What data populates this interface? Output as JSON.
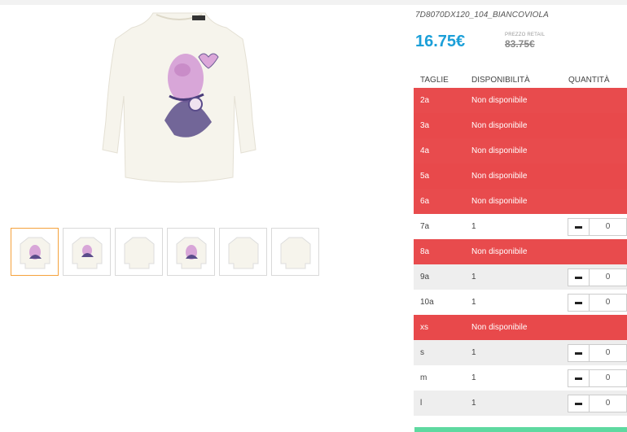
{
  "product": {
    "sku": "7D8070DX120_104_BIANCOVIOLA",
    "price": "16.75€",
    "retail_label": "PREZZO RETAIL",
    "retail_price": "83.75€"
  },
  "table": {
    "headers": [
      "TAGLIE",
      "DISPONIBILITÀ",
      "QUANTITÀ"
    ],
    "rows": [
      {
        "size": "2a",
        "availability": "Non disponibile",
        "qty": null
      },
      {
        "size": "3a",
        "availability": "Non disponibile",
        "qty": null
      },
      {
        "size": "4a",
        "availability": "Non disponibile",
        "qty": null
      },
      {
        "size": "5a",
        "availability": "Non disponibile",
        "qty": null
      },
      {
        "size": "6a",
        "availability": "Non disponibile",
        "qty": null
      },
      {
        "size": "7a",
        "availability": "1",
        "qty": "0"
      },
      {
        "size": "8a",
        "availability": "Non disponibile",
        "qty": null
      },
      {
        "size": "9a",
        "availability": "1",
        "qty": "0"
      },
      {
        "size": "10a",
        "availability": "1",
        "qty": "0"
      },
      {
        "size": "xs",
        "availability": "Non disponibile",
        "qty": null
      },
      {
        "size": "s",
        "availability": "1",
        "qty": "0"
      },
      {
        "size": "m",
        "availability": "1",
        "qty": "0"
      },
      {
        "size": "l",
        "availability": "1",
        "qty": "0"
      }
    ]
  },
  "colors": {
    "price": "#1b9fd8",
    "unavailable_row": "#e8494b",
    "active_thumb_border": "#f5a23c",
    "cta": "#5ed9a0"
  },
  "icons": {
    "minus": "minus-icon"
  }
}
